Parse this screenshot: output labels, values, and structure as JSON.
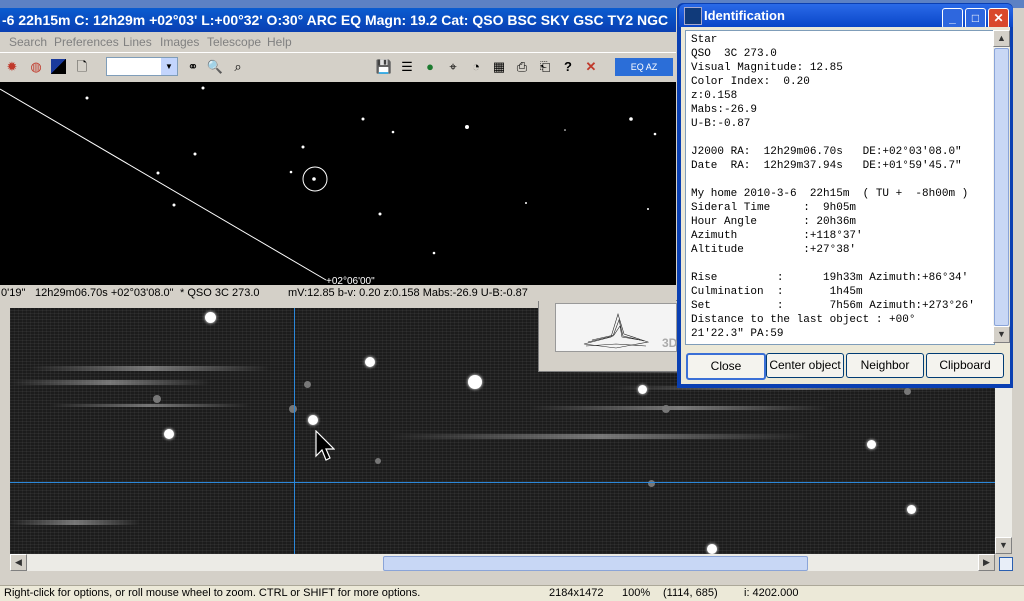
{
  "cdc_window": {
    "title": "-6  22h15m C: 12h29m +02°03' L:+00°32' O:30° ARC EQ Magn: 19.2 Cat: QSO BSC SKY GSC TY2 NGC",
    "menu": [
      "Search",
      "Preferences",
      "Lines",
      "Images",
      "Telescope",
      "Help"
    ],
    "map_label": "+02°06'00\"",
    "map_status": {
      "field0": "0'19\"",
      "coords": "12h29m06.70s +02°03'08.0\"",
      "object": "* QSO  3C 273.0",
      "details": "mV:12.85 b-v: 0.20 z:0.158 Mabs:-26.9 U-B:-0.87"
    }
  },
  "toolbar_icons": [
    "sun-icon",
    "planet-icon",
    "color-icon",
    "page-icon",
    "binoculars-icon",
    "zoom-icon",
    "zoom-out-icon",
    "save-icon",
    "list-icon",
    "globe-icon",
    "telescope-icon",
    "gauge-icon",
    "calendar-icon",
    "print-icon",
    "printer-setup-icon",
    "help-icon",
    "close-icon"
  ],
  "panel3d": {
    "label": "3D"
  },
  "identification": {
    "title": "Identification",
    "text": "Star\nQSO  3C 273.0\nVisual Magnitude: 12.85\nColor Index:  0.20\nz:0.158\nMabs:-26.9\nU-B:-0.87\n\nJ2000 RA:  12h29m06.70s   DE:+02°03'08.0\"\nDate  RA:  12h29m37.94s   DE:+01°59'45.7\"\n\nMy home 2010-3-6  22h15m  ( TU +  -8h00m )\nSideral Time     :  9h05m\nHour Angle       : 20h36m\nAzimuth          :+118°37'\nAltitude         :+27°38'\n\nRise         :      19h33m Azimuth:+86°34'\nCulmination  :       1h45m\nSet          :       7h56m Azimuth:+273°26'\nDistance to the last object : +00°\n21'22.3\" PA:59",
    "buttons": {
      "close": "Close",
      "center": "Center object",
      "neighbor": "Neighbor",
      "clipboard": "Clipboard"
    }
  },
  "status_bar": {
    "hint": "Right-click for options, or roll mouse wheel to zoom. CTRL or SHIFT for more options.",
    "size": "2184x1472",
    "zoom": "100%",
    "cursor": "(1114, 685)",
    "intensity": "i: 4202.000"
  },
  "accent_colors": {
    "title_bar": "#0a46c8",
    "crosshair": "#2b87d9"
  }
}
